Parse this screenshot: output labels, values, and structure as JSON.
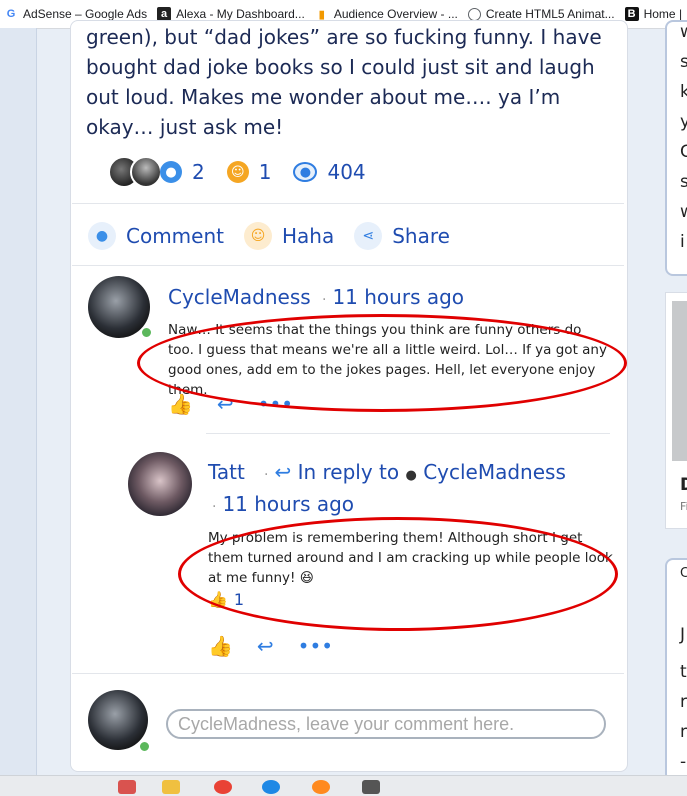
{
  "bookmarks": [
    {
      "icon": "google-g-icon",
      "glyph": "G",
      "label": "AdSense – Google Ads"
    },
    {
      "icon": "alexa-icon",
      "glyph": "a",
      "label": "Alexa - My Dashboard..."
    },
    {
      "icon": "analytics-bars-icon",
      "glyph": "▮",
      "label": "Audience Overview - ..."
    },
    {
      "icon": "globe-icon",
      "glyph": "◎",
      "label": "Create HTML5 Animat..."
    },
    {
      "icon": "b-logo-icon",
      "glyph": "B",
      "label": "Home |"
    }
  ],
  "post": {
    "text": "green), but “dad jokes” are so fucking funny.  I have bought dad joke books so I could just sit and laugh out loud. Makes me wonder about me…. ya I’m okay… just ask me!",
    "stats": {
      "comments": "2",
      "haha": "1",
      "views": "404"
    },
    "actions": {
      "comment": "Comment",
      "haha": "Haha",
      "share": "Share"
    }
  },
  "comments": [
    {
      "author": "CycleMadness",
      "time": "11 hours ago",
      "text": "Naw…  It seems that the things you think are funny others do too. I guess that means we're all a little weird. Lol… If ya got any good ones, add em to the jokes pages. Hell, let everyone enjoy them."
    },
    {
      "author": "Tatt",
      "reply_prefix": "In reply to",
      "reply_to": "CycleMadness",
      "time": "11 hours ago",
      "text": "My problem is remembering them!  Although short I get them turned around and I am cracking up while people look at me funny! 😆",
      "likes": "1"
    }
  ],
  "reply_box": {
    "placeholder": "CycleMadness, leave your comment here."
  },
  "right_column_letters": [
    "w",
    "s",
    "k",
    "y",
    "C",
    "s",
    "w",
    "i"
  ],
  "right_column_letters_2": [
    "D",
    "Fi"
  ],
  "right_column_letters_3": [
    "C",
    "J",
    "t",
    "r",
    "n",
    "-"
  ],
  "colors": {
    "link_blue": "#1f4cb0",
    "icon_blue": "#2f7de1",
    "annotation_red": "#e00000"
  }
}
